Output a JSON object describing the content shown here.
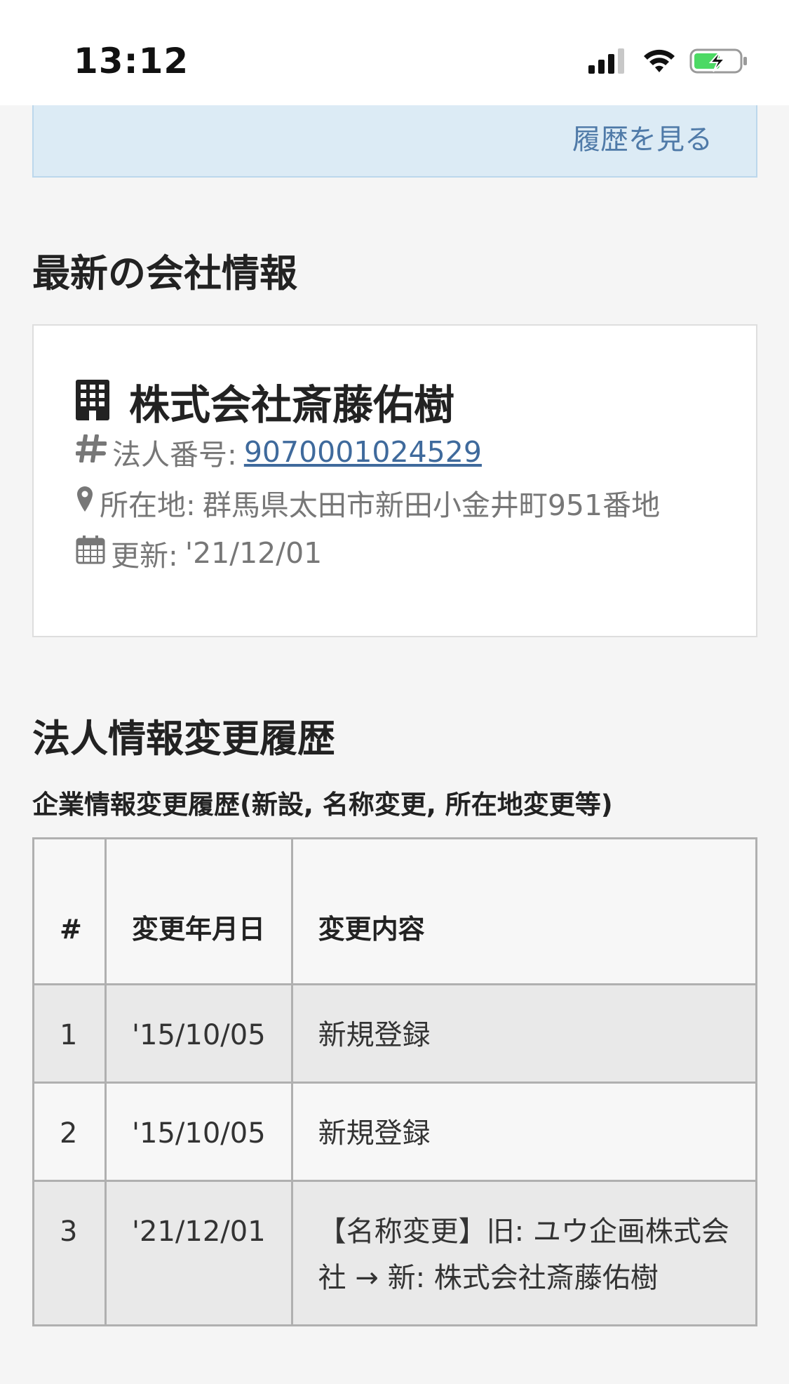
{
  "status_bar": {
    "time": "13:12",
    "icons": [
      "cellular-signal-icon",
      "wifi-icon",
      "battery-charging-icon"
    ],
    "battery_color": "#4cd964"
  },
  "history_banner": {
    "link_label": "履歴を見る"
  },
  "latest_info": {
    "section_title": "最新の会社情報",
    "company_name": "株式会社斎藤佑樹",
    "corp_number_label": "法人番号:",
    "corp_number": "9070001024529",
    "address_label": "所在地:",
    "address": "群馬県太田市新田小金井町951番地",
    "updated_label": "更新:",
    "updated": "'21/12/01"
  },
  "change_history": {
    "section_title": "法人情報変更履歴",
    "caption": "企業情報変更履歴(新設, 名称変更, 所在地変更等)",
    "headers": {
      "num": "#",
      "date": "変更年月日",
      "content": "変更内容"
    },
    "rows": [
      {
        "num": "1",
        "date": "'15/10/05",
        "content": "新規登録"
      },
      {
        "num": "2",
        "date": "'15/10/05",
        "content": "新規登録"
      },
      {
        "num": "3",
        "date": "'21/12/01",
        "content": "【名称変更】旧: ユウ企画株式会社 → 新: 株式会社斎藤佑樹"
      }
    ]
  },
  "colors": {
    "link": "#4f7aa8",
    "corp_number": "#3f6a9c",
    "banner_bg": "#dcebf5"
  }
}
